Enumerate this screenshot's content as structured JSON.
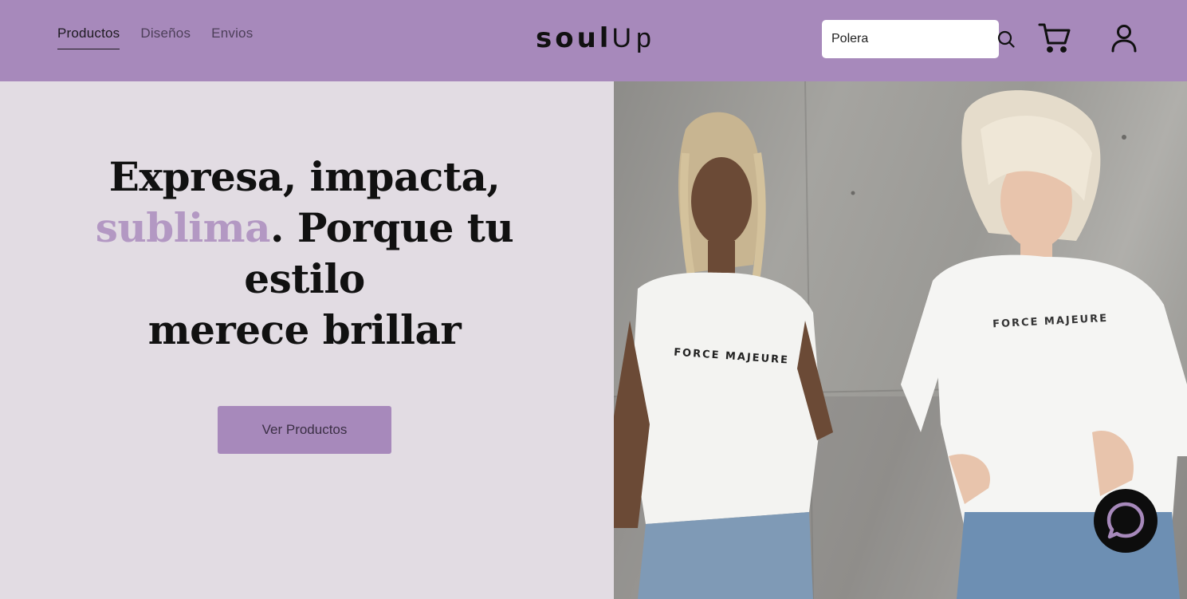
{
  "nav": {
    "items": [
      {
        "label": "Productos",
        "active": true
      },
      {
        "label": "Diseños",
        "active": false
      },
      {
        "label": "Envios",
        "active": false
      }
    ]
  },
  "logo": {
    "part1": "soul",
    "part2": "Up"
  },
  "search": {
    "value": "Polera",
    "icon": "search-icon"
  },
  "header_icons": {
    "cart": "cart-icon",
    "user": "user-icon"
  },
  "hero": {
    "line1": "Expresa, impacta,",
    "accent": "sublima",
    "line2_rest": ". Porque tu estilo",
    "line3": "merece brillar",
    "cta_label": "Ver Productos"
  },
  "photo": {
    "shirt_text": "FORCE MAJEURE"
  },
  "chat": {
    "icon": "chat-bubble-icon"
  },
  "colors": {
    "header_bg": "#a789bb",
    "hero_bg": "#e2dce3",
    "accent": "#b398c3",
    "chat_bg": "#0d0d0d"
  }
}
